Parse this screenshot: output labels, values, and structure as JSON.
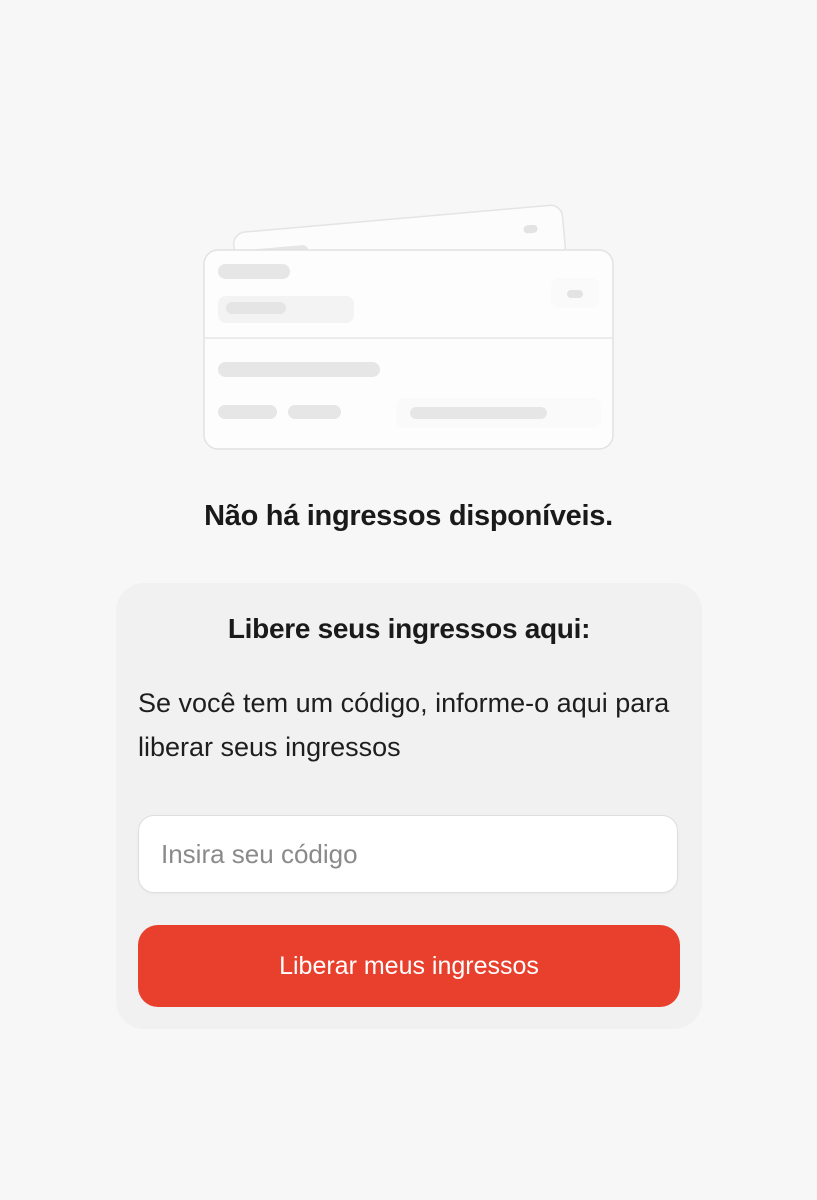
{
  "empty_state": {
    "illustration_icon": "tickets-placeholder-icon",
    "message": "Não há ingressos disponíveis."
  },
  "redeem": {
    "title": "Libere seus ingressos aqui:",
    "description": "Se você tem um código, informe-o aqui para liberar seus ingressos",
    "input_placeholder": "Insira seu código",
    "input_value": "",
    "button_label": "Liberar meus ingressos"
  },
  "colors": {
    "background": "#f7f7f7",
    "card_background": "#f1f1f1",
    "accent": "#e9402d",
    "text": "#1a1a1a"
  }
}
